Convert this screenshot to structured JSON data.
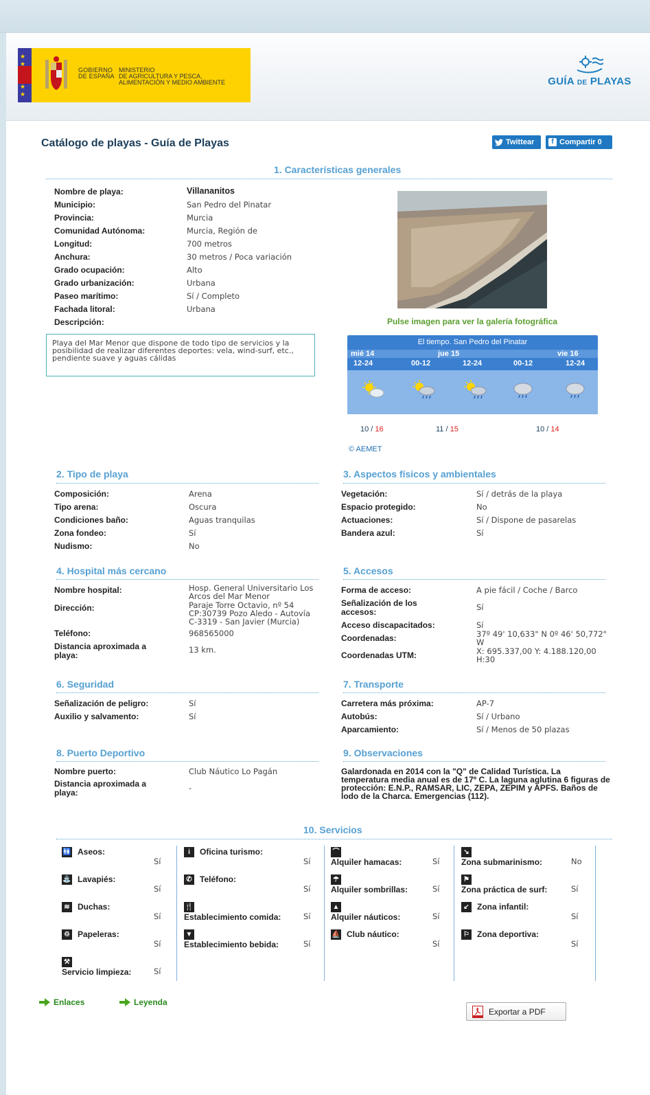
{
  "header": {
    "gov_line1": "GOBIERNO",
    "gov_line2": "DE ESPAÑA",
    "ministry_line1": "MINISTERIO",
    "ministry_line2": "DE AGRICULTURA Y PESCA,",
    "ministry_line3": "ALIMENTACIÓN Y MEDIO AMBIENTE",
    "guia_logo_main": "GUÍA",
    "guia_logo_de": "DE",
    "guia_logo_end": "PLAYAS"
  },
  "page": {
    "title": "Catálogo de playas - Guía de Playas",
    "twitter_label": "Twittear",
    "facebook_label": "Compartir 0"
  },
  "s1": {
    "title": "1. Características generales",
    "fields": [
      {
        "label": "Nombre de playa:",
        "value": "Villananitos"
      },
      {
        "label": "Municipio:",
        "value": "San Pedro del Pinatar"
      },
      {
        "label": "Provincia:",
        "value": "Murcia"
      },
      {
        "label": "Comunidad Autónoma:",
        "value": "Murcia, Región de"
      },
      {
        "label": "Longitud:",
        "value": "700 metros"
      },
      {
        "label": "Anchura:",
        "value": "30 metros / Poca variación"
      },
      {
        "label": "Grado ocupación:",
        "value": "Alto"
      },
      {
        "label": "Grado urbanización:",
        "value": "Urbana"
      },
      {
        "label": "Paseo marítimo:",
        "value": "Sí / Completo"
      },
      {
        "label": "Fachada litoral:",
        "value": "Urbana"
      },
      {
        "label": "Descripción:",
        "value": ""
      }
    ],
    "description": "Playa del Mar Menor que dispone de todo tipo de servicios y la posibilidad de realizar diferentes deportes: vela, wind-surf, etc., pendiente suave y aguas cálidas",
    "photo_caption": "Pulse imagen para ver la galería fotográfica"
  },
  "weather": {
    "title": "El tiempo. San Pedro del Pinatar",
    "days": [
      "mié 14",
      "jue 15",
      "vie 16"
    ],
    "hours": [
      "12-24",
      "00-12",
      "12-24",
      "00-12",
      "12-24"
    ],
    "icons": [
      "sun-cloud-icon",
      "sun-rain-icon",
      "sun-rain-icon",
      "cloud-rain-icon",
      "cloud-rain-icon"
    ],
    "temps": [
      {
        "min": "10",
        "max": "16"
      },
      {
        "min": "11",
        "max": "15"
      },
      {
        "min": "10",
        "max": "14"
      }
    ],
    "temp_sep": " / ",
    "credit": "© AEMET"
  },
  "s2": {
    "title": "2. Tipo de playa",
    "fields": [
      {
        "label": "Composición:",
        "value": "Arena"
      },
      {
        "label": "Tipo arena:",
        "value": "Oscura"
      },
      {
        "label": "Condiciones baño:",
        "value": "Aguas tranquilas"
      },
      {
        "label": "Zona fondeo:",
        "value": "Sí"
      },
      {
        "label": "Nudismo:",
        "value": "No"
      }
    ]
  },
  "s3": {
    "title": "3. Aspectos físicos y ambientales",
    "fields": [
      {
        "label": "Vegetación:",
        "value": "Sí / detrás de la playa"
      },
      {
        "label": "Espacio protegido:",
        "value": "No"
      },
      {
        "label": "Actuaciones:",
        "value": "Sí / Dispone de pasarelas"
      },
      {
        "label": "Bandera azul:",
        "value": "Sí"
      }
    ]
  },
  "s4": {
    "title": "4. Hospital más cercano",
    "hospital_label": "Nombre hospital:",
    "hospital_value": "Hosp. General Universitario Los Arcos del Mar Menor",
    "address_label": "Dirección:",
    "address_value": "Paraje Torre Octavio, nº 54 CP:30739 Pozo Aledo - Autovía C-3319 - San Javier (Murcia)",
    "phone_label": "Teléfono:",
    "phone_value": "968565000",
    "distance_label": "Distancia aproximada a playa:",
    "distance_value": "13 km."
  },
  "s5": {
    "title": "5. Accesos",
    "access_label": "Forma de acceso:",
    "access_value": "A pie fácil / Coche / Barco",
    "signage_label": "Señalización de los accesos:",
    "signage_value": "Sí",
    "disabled_label": "Acceso discapacitados:",
    "disabled_value": "Sí",
    "coords_label": "Coordenadas:",
    "coords_value": "37º 49' 10,633\" N 0º 46' 50,772\" W",
    "utm_label": "Coordenadas UTM:",
    "utm_value": "X: 695.337,00 Y: 4.188.120,00 H:30"
  },
  "s6": {
    "title": "6. Seguridad",
    "fields": [
      {
        "label": "Señalización de peligro:",
        "value": "Sí"
      },
      {
        "label": "Auxilio y salvamento:",
        "value": "Sí"
      }
    ]
  },
  "s7": {
    "title": "7. Transporte",
    "fields": [
      {
        "label": "Carretera más próxima:",
        "value": "AP-7"
      },
      {
        "label": "Autobús:",
        "value": "Sí / Urbano"
      },
      {
        "label": "Aparcamiento:",
        "value": "Sí / Menos de 50 plazas"
      }
    ]
  },
  "s8": {
    "title": "8. Puerto Deportivo",
    "port_label": "Nombre puerto:",
    "port_value": "Club Náutico Lo Pagán",
    "distance_label": "Distancia aproximada a playa:",
    "distance_value": "-"
  },
  "s9": {
    "title": "9. Observaciones",
    "text": "Galardonada en 2014 con la \"Q\" de Calidad Turística. La temperatura media anual es de 17º C. La laguna aglutina 6 figuras de protección: E.N.P., RAMSAR, LIC, ZEPA, ZEPIM y APFS. Baños de lodo de la Charca. Emergencias (112)."
  },
  "s10": {
    "title": "10. Servicios",
    "col1": [
      {
        "label": "Aseos:",
        "value": "Sí",
        "icon": "toilets-icon"
      },
      {
        "label": "Lavapiés:",
        "value": "Sí",
        "icon": "footwash-icon"
      },
      {
        "label": "Duchas:",
        "value": "Sí",
        "icon": "shower-icon"
      },
      {
        "label": "Papeleras:",
        "value": "Sí",
        "icon": "bin-icon"
      },
      {
        "label": "Servicio limpieza:",
        "value": "Sí",
        "icon": "cleaning-icon"
      }
    ],
    "col2": [
      {
        "label": "Oficina turismo:",
        "value": "Sí",
        "icon": "info-icon"
      },
      {
        "label": "Teléfono:",
        "value": "Sí",
        "icon": "phone-icon"
      },
      {
        "label": "Establecimiento comida:",
        "value": "Sí",
        "icon": "cutlery-icon"
      },
      {
        "label": "Establecimiento bebida:",
        "value": "Sí",
        "icon": "drink-icon"
      }
    ],
    "col3": [
      {
        "label": "Alquiler hamacas:",
        "value": "Sí",
        "icon": "deckchair-icon"
      },
      {
        "label": "Alquiler sombrillas:",
        "value": "Sí",
        "icon": "umbrella-icon"
      },
      {
        "label": "Alquiler náuticos:",
        "value": "Sí",
        "icon": "sailboat-icon"
      },
      {
        "label": "Club náutico:",
        "value": "Sí",
        "icon": "boat-icon"
      }
    ],
    "col4": [
      {
        "label": "Zona submarinismo:",
        "value": "No",
        "icon": "diver-icon"
      },
      {
        "label": "Zona práctica de surf:",
        "value": "Sí",
        "icon": "surf-icon"
      },
      {
        "label": "Zona infantil:",
        "value": "Sí",
        "icon": "slide-icon"
      },
      {
        "label": "Zona deportiva:",
        "value": "Sí",
        "icon": "runner-icon"
      }
    ]
  },
  "footer": {
    "links_label": "Enlaces",
    "legend_label": "Leyenda",
    "pdf_label": "Exportar a PDF"
  },
  "colors": {
    "section_title": "#56a0d2",
    "title": "#1c3e5a",
    "weather_header": "#3a7fd0",
    "link_green": "#2a8a1e",
    "temp_max": "#e02020"
  }
}
